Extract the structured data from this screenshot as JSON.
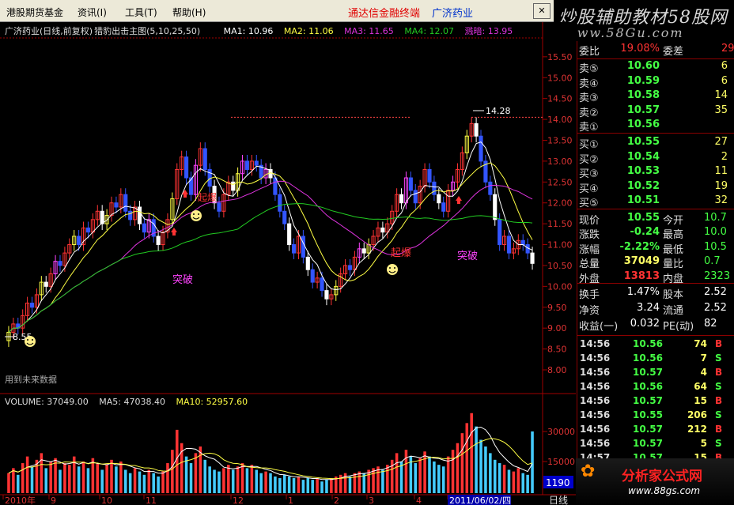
{
  "menu": {
    "items": [
      "港股期货基金",
      "资讯(I)",
      "工具(T)",
      "帮助(H)"
    ],
    "brand_title": "通达信金融终端",
    "stock_name": "广济药业"
  },
  "watermark_top": {
    "line1": "炒股辅助教材58股网",
    "line2": "www.58Gu.com"
  },
  "watermark_bottom": {
    "line1": "分析家公式网",
    "line2": "www.88gs.com"
  },
  "chart_header": {
    "title": "广济药业(日线,前复权)",
    "indicator": "猎豹出击主图(5,10,25,50)",
    "ma1": "MA1: 10.96",
    "ma2": "MA2: 11.06",
    "ma3": "MA3: 11.65",
    "ma4": "MA4: 12.07",
    "kd": "溅暗: 13.95"
  },
  "volume_header": {
    "volume": "VOLUME: 37049.00",
    "ma5": "MA5: 47038.40",
    "ma10": "MA10: 52957.60"
  },
  "annotations": {
    "low_label": "8.55",
    "high_label": "14.28",
    "breakout1": "突破",
    "rise": "起爆",
    "breakout2": "突破",
    "corner_note": "用到未来数据",
    "corner_value": "1190",
    "period": "日线"
  },
  "colors": {
    "up": "#ff3333",
    "down": "#3355ff",
    "ma_white": "#ffffff",
    "ma_yellow": "#ffff44",
    "ma_green": "#22cc22",
    "ma_magenta": "#dd33dd",
    "accent_magenta": "#ff44ff",
    "label_up": "#ff3333",
    "label_down": "#44ff44"
  },
  "price_axis": [
    "15.50",
    "15.00",
    "14.50",
    "14.00",
    "13.50",
    "13.00",
    "12.50",
    "12.00",
    "11.50",
    "11.00",
    "10.50",
    "10.00",
    "9.50",
    "9.00",
    "8.50",
    "8.00"
  ],
  "volume_axis": [
    "30000",
    "15000"
  ],
  "date_axis": [
    "2010年",
    "9",
    "10",
    "11",
    "12",
    "1",
    "2",
    "3",
    "4",
    "2011/06/02/四"
  ],
  "quote": {
    "weibi_label": "委比",
    "weibi_value": "19.08%",
    "weicha_label": "委差",
    "weicha_value": "29",
    "asks": [
      {
        "label": "卖⑤",
        "price": "10.60",
        "vol": "6"
      },
      {
        "label": "卖④",
        "price": "10.59",
        "vol": "6"
      },
      {
        "label": "卖③",
        "price": "10.58",
        "vol": "14"
      },
      {
        "label": "卖②",
        "price": "10.57",
        "vol": "35"
      },
      {
        "label": "卖①",
        "price": "10.56",
        "vol": ""
      }
    ],
    "bids": [
      {
        "label": "买①",
        "price": "10.55",
        "vol": "27"
      },
      {
        "label": "买②",
        "price": "10.54",
        "vol": "2"
      },
      {
        "label": "买③",
        "price": "10.53",
        "vol": "11"
      },
      {
        "label": "买④",
        "price": "10.52",
        "vol": "19"
      },
      {
        "label": "买⑤",
        "price": "10.51",
        "vol": "32"
      }
    ],
    "stats": [
      {
        "l1": "现价",
        "v1": "10.55",
        "c1": "#44ff44",
        "l2": "今开",
        "v2": "10.7"
      },
      {
        "l1": "涨跌",
        "v1": "-0.24",
        "c1": "#44ff44",
        "l2": "最高",
        "v2": "10.0"
      },
      {
        "l1": "涨幅",
        "v1": "-2.22%",
        "c1": "#44ff44",
        "l2": "最低",
        "v2": "10.5"
      },
      {
        "l1": "总量",
        "v1": "37049",
        "c1": "#ffff66",
        "l2": "量比",
        "v2": "0.7"
      },
      {
        "l1": "外盘",
        "v1": "13813",
        "c1": "#ff3333",
        "l2": "内盘",
        "v2": "2323"
      }
    ],
    "stats2": [
      {
        "l1": "换手",
        "v1": "1.47%",
        "l2": "股本",
        "v2": "2.52"
      },
      {
        "l1": "净资",
        "v1": "3.24",
        "l2": "流通",
        "v2": "2.52"
      },
      {
        "l1": "收益(一)",
        "v1": "0.032",
        "l2": "PE(动)",
        "v2": "82"
      }
    ],
    "ticks": [
      {
        "time": "14:56",
        "price": "10.56",
        "vol": "74",
        "side": "B"
      },
      {
        "time": "14:56",
        "price": "10.56",
        "vol": "7",
        "side": "S"
      },
      {
        "time": "14:56",
        "price": "10.57",
        "vol": "4",
        "side": "B"
      },
      {
        "time": "14:56",
        "price": "10.56",
        "vol": "64",
        "side": "S"
      },
      {
        "time": "14:56",
        "price": "10.57",
        "vol": "15",
        "side": "B"
      },
      {
        "time": "14:56",
        "price": "10.55",
        "vol": "206",
        "side": "S"
      },
      {
        "time": "14:56",
        "price": "10.57",
        "vol": "212",
        "side": "B"
      },
      {
        "time": "14:56",
        "price": "10.57",
        "vol": "5",
        "side": "S"
      },
      {
        "time": "14:57",
        "price": "10.57",
        "vol": "15",
        "side": "B"
      }
    ]
  },
  "chart_data": {
    "type": "candlestick",
    "price_range": [
      8.0,
      15.8
    ],
    "closes": [
      8.9,
      9.1,
      9.0,
      9.3,
      9.6,
      9.5,
      9.8,
      10.1,
      10.0,
      10.3,
      10.6,
      10.5,
      10.8,
      11.0,
      11.2,
      11.0,
      11.4,
      11.3,
      11.6,
      11.8,
      11.5,
      11.7,
      12.0,
      11.9,
      12.2,
      11.8,
      11.6,
      11.9,
      11.5,
      11.3,
      11.6,
      11.2,
      11.0,
      11.3,
      11.6,
      12.1,
      12.8,
      13.1,
      12.6,
      12.2,
      12.9,
      13.3,
      12.8,
      12.4,
      12.0,
      11.8,
      12.2,
      12.5,
      12.3,
      12.7,
      13.0,
      12.8,
      13.0,
      12.9,
      12.6,
      12.8,
      12.6,
      12.2,
      11.8,
      11.5,
      11.0,
      10.8,
      11.2,
      10.7,
      10.4,
      10.1,
      10.2,
      9.9,
      9.7,
      9.8,
      10.0,
      10.3,
      10.5,
      10.4,
      10.7,
      10.9,
      10.8,
      11.0,
      11.2,
      11.4,
      11.3,
      11.5,
      11.8,
      12.2,
      12.0,
      12.6,
      12.3,
      12.0,
      12.4,
      12.8,
      12.5,
      12.2,
      12.0,
      11.8,
      12.3,
      12.5,
      12.8,
      13.2,
      13.6,
      13.9,
      13.6,
      13.0,
      12.5,
      12.2,
      11.6,
      11.0,
      11.2,
      10.8,
      10.9,
      11.1,
      11.0,
      10.8,
      10.55
    ],
    "volumes": [
      12000,
      15000,
      11000,
      18000,
      22000,
      16000,
      20000,
      24000,
      15000,
      19000,
      21000,
      14000,
      18000,
      17000,
      22000,
      16000,
      19000,
      15000,
      21000,
      18000,
      14000,
      17000,
      20000,
      16000,
      19000,
      14000,
      12000,
      15000,
      13000,
      11000,
      14000,
      12000,
      10000,
      13000,
      18000,
      26000,
      38000,
      30000,
      22000,
      18000,
      24000,
      28000,
      20000,
      16000,
      14000,
      13000,
      15000,
      17000,
      14000,
      16000,
      18000,
      15000,
      17000,
      14000,
      12000,
      13000,
      12000,
      10000,
      9000,
      11000,
      10000,
      9000,
      10000,
      8000,
      9000,
      8000,
      9000,
      7000,
      8000,
      9000,
      10000,
      11000,
      12000,
      10000,
      12000,
      13000,
      12000,
      14000,
      15000,
      16000,
      14000,
      17000,
      20000,
      24000,
      19000,
      26000,
      22000,
      18000,
      21000,
      25000,
      22000,
      19000,
      17000,
      16000,
      22000,
      26000,
      30000,
      36000,
      42000,
      48000,
      40000,
      32000,
      28000,
      24000,
      20000,
      18000,
      17000,
      14000,
      13000,
      15000,
      12000,
      11000,
      37049
    ]
  }
}
